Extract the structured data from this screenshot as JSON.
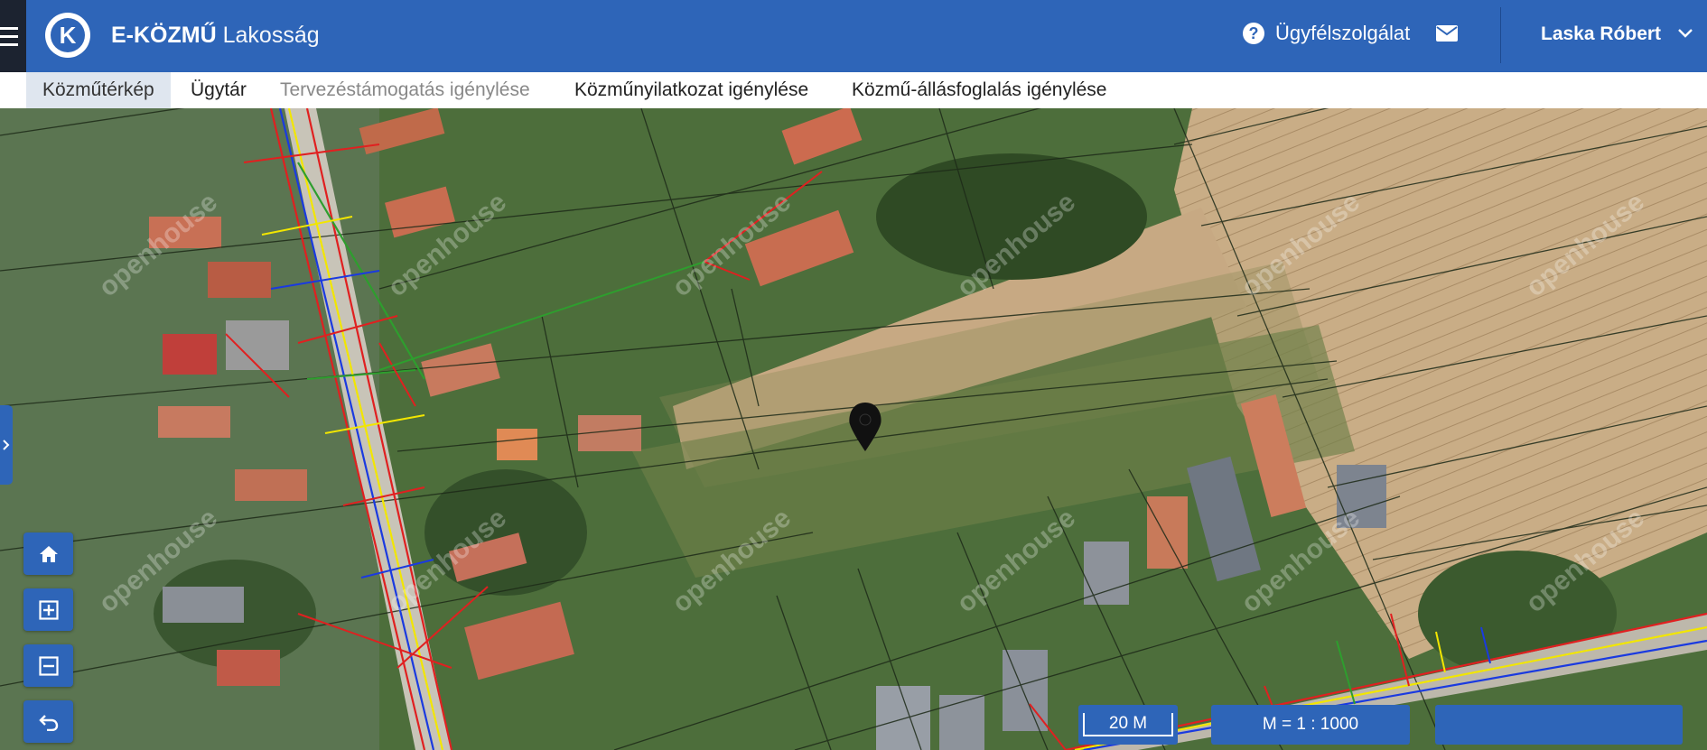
{
  "header": {
    "brand_strong": "E-KÖZMŰ",
    "brand_light": "Lakosság",
    "logo_letter": "K",
    "help_label": "Ügyfélszolgálat",
    "user_name": "Laska Róbert",
    "colors": {
      "bar": "#2e65b8",
      "menu_bg": "#1c2330"
    }
  },
  "tabs": [
    {
      "label": "Közműtérkép",
      "state": "active"
    },
    {
      "label": "Ügytár",
      "state": "normal"
    },
    {
      "label": "Tervezéstámogatás igénylése",
      "state": "disabled"
    },
    {
      "label": "Közműnyilatkozat igénylése",
      "state": "normal"
    },
    {
      "label": "Közmű-állásfoglalás igénylése",
      "state": "normal"
    }
  ],
  "map": {
    "watermark_text": "openhouse",
    "icons": [
      "home-icon",
      "zoom-in-icon",
      "zoom-out-icon",
      "back-icon",
      "location-pin-icon"
    ],
    "scale_bar_label": "20 M",
    "scale_ratio_label": "M = 1 : 1000",
    "utility_line_colors": [
      "#e02020",
      "#f2e600",
      "#1a3ae0",
      "#2e9e2e"
    ]
  }
}
